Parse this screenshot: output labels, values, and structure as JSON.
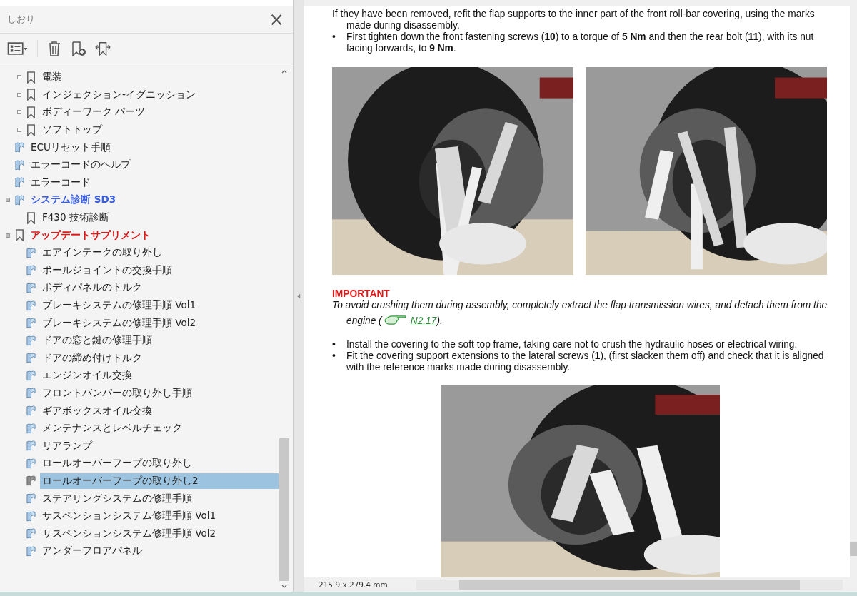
{
  "sidebar": {
    "title": "しおり",
    "close_icon": "×",
    "bookmarks": [
      {
        "children": [
          {
            "label": "電装",
            "kind": "outline",
            "expanded": false,
            "selected": false
          },
          {
            "label": "インジェクション-イグニッション",
            "kind": "outline",
            "expanded": false,
            "selected": false
          },
          {
            "label": "ボディーワーク パーツ",
            "kind": "outline",
            "expanded": false,
            "selected": false
          },
          {
            "label": "ソフトトップ",
            "kind": "outline",
            "expanded": false,
            "selected": false
          }
        ]
      },
      {
        "label": "ECUリセット手順",
        "kind": "page",
        "selected": false
      },
      {
        "label": "エラーコードのヘルプ",
        "kind": "page",
        "selected": false
      },
      {
        "label": "エラーコード",
        "kind": "page",
        "selected": false
      },
      {
        "label": "システム診断 SD3",
        "kind": "page",
        "expanded": true,
        "selected": false,
        "color": "#3a5ee0",
        "bold": true,
        "children": [
          {
            "label": "F430 技術診断",
            "kind": "outline",
            "selected": false
          }
        ]
      },
      {
        "label": "アップデートサプリメント",
        "kind": "outline",
        "expanded": true,
        "selected": false,
        "color": "#e01818",
        "bold": true,
        "children": [
          {
            "label": "エアインテークの取り外し",
            "kind": "page",
            "selected": false
          },
          {
            "label": "ボールジョイントの交換手順",
            "kind": "page",
            "selected": false
          },
          {
            "label": "ボディパネルのトルク",
            "kind": "page",
            "selected": false
          },
          {
            "label": "ブレーキシステムの修理手順 Vol1",
            "kind": "page",
            "selected": false
          },
          {
            "label": "ブレーキシステムの修理手順 Vol2",
            "kind": "page",
            "selected": false
          },
          {
            "label": "ドアの窓と鍵の修理手順",
            "kind": "page",
            "selected": false
          },
          {
            "label": "ドアの締め付けトルク",
            "kind": "page",
            "selected": false
          },
          {
            "label": "エンジンオイル交換",
            "kind": "page",
            "selected": false
          },
          {
            "label": "フロントバンパーの取り外し手順",
            "kind": "page",
            "selected": false
          },
          {
            "label": "ギアボックスオイル交換",
            "kind": "page",
            "selected": false
          },
          {
            "label": "メンテナンスとレベルチェック",
            "kind": "page",
            "selected": false
          },
          {
            "label": "リアランプ",
            "kind": "page",
            "selected": false
          },
          {
            "label": "ロールオーバーフープの取り外し",
            "kind": "page",
            "selected": false
          },
          {
            "label": "ロールオーバーフープの取り外し2",
            "kind": "page",
            "selected": true
          },
          {
            "label": "ステアリングシステムの修理手順",
            "kind": "page",
            "selected": false
          },
          {
            "label": "サスペンションシステム修理手順 Vol1",
            "kind": "page",
            "selected": false
          },
          {
            "label": "サスペンションシステム修理手順 Vol2",
            "kind": "page",
            "selected": false
          },
          {
            "label": "アンダーフロアパネル",
            "kind": "page",
            "selected": false,
            "hovered": true
          }
        ]
      }
    ]
  },
  "document": {
    "top_paragraphs": [
      {
        "text": "If they have been removed, refit the flap supports to the inner part of the front roll-bar covering, using the marks made during disassembly."
      },
      {
        "bullet": "•",
        "text": "First tighten down the front fastening screws (**10**) to a torque of **5 Nm** and then the rear bolt (**11**), with its nut facing forwards, to **9 Nm**."
      }
    ],
    "important": {
      "heading": "IMPORTANT",
      "text": "To avoid crushing them during assembly, completely extract the flap transmission wires, and detach them from the engine (",
      "link": "N2.17",
      "after": ")."
    },
    "bullets": [
      {
        "bullet": "•",
        "text": "Install the covering to the soft top frame, taking care not to crush the hydraulic hoses or electrical wiring."
      },
      {
        "bullet": "•",
        "text": "Fit the covering support extensions to the lateral screws (**1**), (first slacken them off) and check that it is aligned with the reference marks made during disassembly."
      }
    ]
  },
  "status_bar": {
    "page_size": "215.9 x 279.4 mm"
  }
}
